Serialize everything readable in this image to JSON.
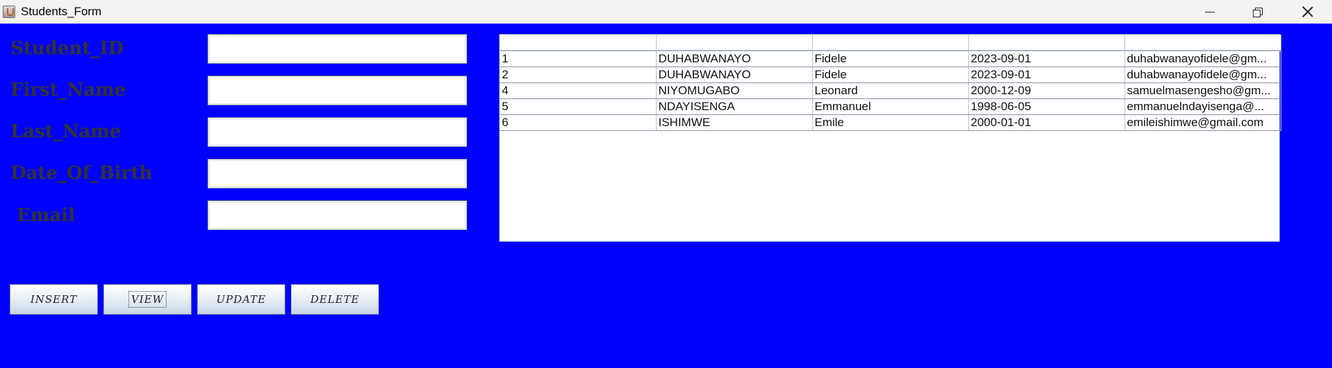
{
  "window": {
    "title": "Students_Form",
    "icon": "java-cup-icon",
    "background_color": "#0000ff"
  },
  "form": {
    "labels": [
      "Student_ID",
      "First_Name",
      "Last_Name",
      "Date_Of_Birth",
      " Email"
    ],
    "values": [
      "",
      "",
      "",
      "",
      ""
    ]
  },
  "table": {
    "headers": [
      "",
      "",
      "",
      "",
      ""
    ],
    "rows": [
      [
        "1",
        "DUHABWANAYO",
        "Fidele",
        "2023-09-01",
        "duhabwanayofidele@gm..."
      ],
      [
        "2",
        "DUHABWANAYO",
        "Fidele",
        "2023-09-01",
        "duhabwanayofidele@gm..."
      ],
      [
        "4",
        "NIYOMUGABO",
        "Leonard",
        "2000-12-09",
        "samuelmasengesho@gm..."
      ],
      [
        "5",
        "NDAYISENGA",
        "Emmanuel",
        "1998-06-05",
        "emmanuelndayisenga@..."
      ],
      [
        "6",
        "ISHIMWE",
        "Emile",
        "2000-01-01",
        "emileishimwe@gmail.com"
      ]
    ]
  },
  "buttons": {
    "insert": "INSERT",
    "view": "VIEW",
    "update": "UPDATE",
    "delete": "DELETE"
  }
}
